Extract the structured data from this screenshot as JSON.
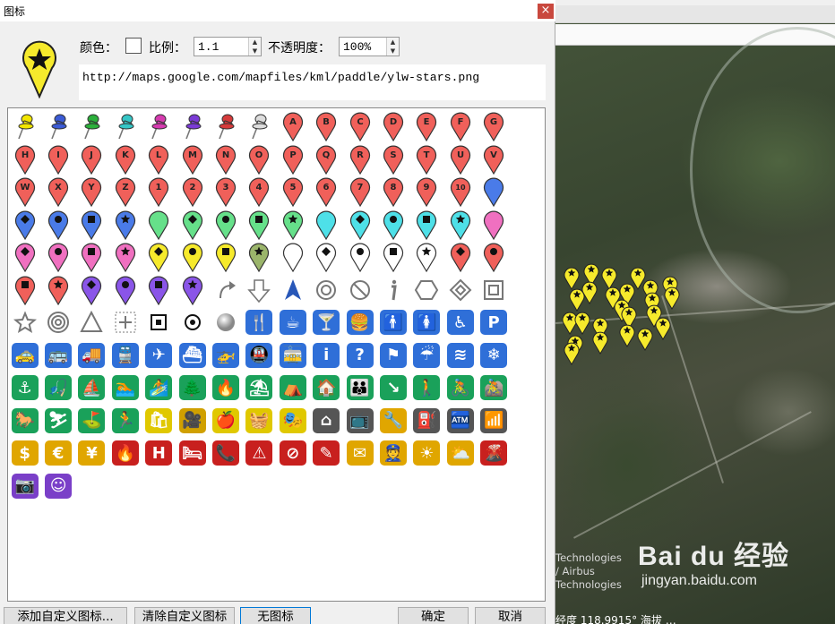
{
  "window": {
    "title": "图标",
    "close_glyph": "×"
  },
  "preview_icon": {
    "color": "#f6ea2c",
    "icon": "star-paddle-icon"
  },
  "controls": {
    "color_label": "颜色：",
    "scale_label": "比例：",
    "scale_value": "1.1",
    "opacity_label": "不透明度：",
    "opacity_value": "100%"
  },
  "icon_url": "http://maps.google.com/mapfiles/kml/paddle/ylw-stars.png",
  "icon_grid": {
    "rows": [
      [
        {
          "t": "pushpin",
          "c": "#f2e600"
        },
        {
          "t": "pushpin",
          "c": "#3b5bd6"
        },
        {
          "t": "pushpin",
          "c": "#2bb03b"
        },
        {
          "t": "pushpin",
          "c": "#35c6c6"
        },
        {
          "t": "pushpin",
          "c": "#d63bb0"
        },
        {
          "t": "pushpin",
          "c": "#7b3bd6"
        },
        {
          "t": "pushpin",
          "c": "#d63b3b"
        },
        {
          "t": "pushpin",
          "c": "#dddddd"
        },
        {
          "t": "paddle",
          "c": "#f0605a",
          "l": "A"
        },
        {
          "t": "paddle",
          "c": "#f0605a",
          "l": "B"
        },
        {
          "t": "paddle",
          "c": "#f0605a",
          "l": "C"
        },
        {
          "t": "paddle",
          "c": "#f0605a",
          "l": "D"
        },
        {
          "t": "paddle",
          "c": "#f0605a",
          "l": "E"
        },
        {
          "t": "paddle",
          "c": "#f0605a",
          "l": "F"
        },
        {
          "t": "paddle",
          "c": "#f0605a",
          "l": "G"
        }
      ],
      [
        {
          "t": "paddle",
          "c": "#f0605a",
          "l": "H"
        },
        {
          "t": "paddle",
          "c": "#f0605a",
          "l": "I"
        },
        {
          "t": "paddle",
          "c": "#f0605a",
          "l": "J"
        },
        {
          "t": "paddle",
          "c": "#f0605a",
          "l": "K"
        },
        {
          "t": "paddle",
          "c": "#f0605a",
          "l": "L"
        },
        {
          "t": "paddle",
          "c": "#f0605a",
          "l": "M"
        },
        {
          "t": "paddle",
          "c": "#f0605a",
          "l": "N"
        },
        {
          "t": "paddle",
          "c": "#f0605a",
          "l": "O"
        },
        {
          "t": "paddle",
          "c": "#f0605a",
          "l": "P"
        },
        {
          "t": "paddle",
          "c": "#f0605a",
          "l": "Q"
        },
        {
          "t": "paddle",
          "c": "#f0605a",
          "l": "R"
        },
        {
          "t": "paddle",
          "c": "#f0605a",
          "l": "S"
        },
        {
          "t": "paddle",
          "c": "#f0605a",
          "l": "T"
        },
        {
          "t": "paddle",
          "c": "#f0605a",
          "l": "U"
        },
        {
          "t": "paddle",
          "c": "#f0605a",
          "l": "V"
        }
      ],
      [
        {
          "t": "paddle",
          "c": "#f0605a",
          "l": "W"
        },
        {
          "t": "paddle",
          "c": "#f0605a",
          "l": "X"
        },
        {
          "t": "paddle",
          "c": "#f0605a",
          "l": "Y"
        },
        {
          "t": "paddle",
          "c": "#f0605a",
          "l": "Z"
        },
        {
          "t": "paddle",
          "c": "#f0605a",
          "l": "1"
        },
        {
          "t": "paddle",
          "c": "#f0605a",
          "l": "2"
        },
        {
          "t": "paddle",
          "c": "#f0605a",
          "l": "3"
        },
        {
          "t": "paddle",
          "c": "#f0605a",
          "l": "4"
        },
        {
          "t": "paddle",
          "c": "#f0605a",
          "l": "5"
        },
        {
          "t": "paddle",
          "c": "#f0605a",
          "l": "6"
        },
        {
          "t": "paddle",
          "c": "#f0605a",
          "l": "7"
        },
        {
          "t": "paddle",
          "c": "#f0605a",
          "l": "8"
        },
        {
          "t": "paddle",
          "c": "#f0605a",
          "l": "9"
        },
        {
          "t": "paddle",
          "c": "#f0605a",
          "l": "10"
        },
        {
          "t": "paddle",
          "c": "#4a7be8",
          "l": ""
        }
      ],
      [
        {
          "t": "paddle",
          "c": "#4a7be8",
          "s": "diamond"
        },
        {
          "t": "paddle",
          "c": "#4a7be8",
          "s": "circle"
        },
        {
          "t": "paddle",
          "c": "#4a7be8",
          "s": "square"
        },
        {
          "t": "paddle",
          "c": "#4a7be8",
          "s": "star"
        },
        {
          "t": "paddle",
          "c": "#66e08a",
          "l": ""
        },
        {
          "t": "paddle",
          "c": "#66e08a",
          "s": "diamond"
        },
        {
          "t": "paddle",
          "c": "#66e08a",
          "s": "circle"
        },
        {
          "t": "paddle",
          "c": "#66e08a",
          "s": "square"
        },
        {
          "t": "paddle",
          "c": "#66e08a",
          "s": "star"
        },
        {
          "t": "paddle",
          "c": "#4ee0e8",
          "l": ""
        },
        {
          "t": "paddle",
          "c": "#4ee0e8",
          "s": "diamond"
        },
        {
          "t": "paddle",
          "c": "#4ee0e8",
          "s": "circle"
        },
        {
          "t": "paddle",
          "c": "#4ee0e8",
          "s": "square"
        },
        {
          "t": "paddle",
          "c": "#4ee0e8",
          "s": "star"
        },
        {
          "t": "paddle",
          "c": "#f070c0",
          "l": ""
        }
      ],
      [
        {
          "t": "paddle",
          "c": "#f070c0",
          "s": "diamond"
        },
        {
          "t": "paddle",
          "c": "#f070c0",
          "s": "circle"
        },
        {
          "t": "paddle",
          "c": "#f070c0",
          "s": "square"
        },
        {
          "t": "paddle",
          "c": "#f070c0",
          "s": "star"
        },
        {
          "t": "paddle",
          "c": "#f6ea2c",
          "s": "diamond"
        },
        {
          "t": "paddle",
          "c": "#f6ea2c",
          "s": "circle"
        },
        {
          "t": "paddle",
          "c": "#f6ea2c",
          "s": "square"
        },
        {
          "t": "paddle",
          "c": "#9bb56b",
          "s": "star"
        },
        {
          "t": "paddle",
          "c": "#ffffff",
          "l": ""
        },
        {
          "t": "paddle",
          "c": "#ffffff",
          "s": "diamond"
        },
        {
          "t": "paddle",
          "c": "#ffffff",
          "s": "circle"
        },
        {
          "t": "paddle",
          "c": "#ffffff",
          "s": "square"
        },
        {
          "t": "paddle",
          "c": "#ffffff",
          "s": "star"
        },
        {
          "t": "paddle",
          "c": "#f0605a",
          "s": "diamond"
        },
        {
          "t": "paddle",
          "c": "#f0605a",
          "s": "circle"
        }
      ],
      [
        {
          "t": "paddle",
          "c": "#f0605a",
          "s": "square"
        },
        {
          "t": "paddle",
          "c": "#f0605a",
          "s": "star"
        },
        {
          "t": "paddle",
          "c": "#8a55e8",
          "s": "diamond"
        },
        {
          "t": "paddle",
          "c": "#8a55e8",
          "s": "circle"
        },
        {
          "t": "paddle",
          "c": "#8a55e8",
          "s": "square"
        },
        {
          "t": "paddle",
          "c": "#8a55e8",
          "s": "star"
        },
        {
          "t": "shape",
          "n": "curved-arrow"
        },
        {
          "t": "shape",
          "n": "down-arrow"
        },
        {
          "t": "shape",
          "n": "nav-arrow"
        },
        {
          "t": "shape",
          "n": "ring"
        },
        {
          "t": "shape",
          "n": "no-entry"
        },
        {
          "t": "shape",
          "n": "info-i"
        },
        {
          "t": "shape",
          "n": "hexagon"
        },
        {
          "t": "shape",
          "n": "diamond-outline"
        },
        {
          "t": "shape",
          "n": "square-outline"
        }
      ],
      [
        {
          "t": "shape",
          "n": "star-outline"
        },
        {
          "t": "shape",
          "n": "target"
        },
        {
          "t": "shape",
          "n": "triangle"
        },
        {
          "t": "shape",
          "n": "cross-hair"
        },
        {
          "t": "shape",
          "n": "square-dot"
        },
        {
          "t": "shape",
          "n": "circle-dot"
        },
        {
          "t": "shape",
          "n": "grey-sphere"
        },
        {
          "t": "sym",
          "g": "🍴"
        },
        {
          "t": "sym",
          "g": "☕"
        },
        {
          "t": "sym",
          "g": "🍸"
        },
        {
          "t": "sym",
          "g": "🍔"
        },
        {
          "t": "sym",
          "g": "🚹"
        },
        {
          "t": "sym",
          "g": "🚺"
        },
        {
          "t": "sym",
          "g": "♿"
        },
        {
          "t": "sym",
          "g": "P"
        }
      ],
      [
        {
          "t": "sym",
          "g": "🚕"
        },
        {
          "t": "sym",
          "g": "🚌"
        },
        {
          "t": "sym",
          "g": "🚚"
        },
        {
          "t": "sym",
          "g": "🚆"
        },
        {
          "t": "sym",
          "g": "✈"
        },
        {
          "t": "sym",
          "g": "⛴"
        },
        {
          "t": "sym",
          "g": "🚁"
        },
        {
          "t": "sym",
          "g": "🚇"
        },
        {
          "t": "sym",
          "g": "🚋"
        },
        {
          "t": "sym",
          "g": "i"
        },
        {
          "t": "sym",
          "g": "?"
        },
        {
          "t": "sym",
          "g": "⚑"
        },
        {
          "t": "sym",
          "g": "☔"
        },
        {
          "t": "sym",
          "g": "≋"
        },
        {
          "t": "sym",
          "g": "❄"
        }
      ],
      [
        {
          "t": "sym",
          "g": "⚓"
        },
        {
          "t": "sym",
          "g": "🎣"
        },
        {
          "t": "sym",
          "g": "⛵"
        },
        {
          "t": "sym",
          "g": "🏊"
        },
        {
          "t": "sym",
          "g": "🏄"
        },
        {
          "t": "sym",
          "g": "🌲"
        },
        {
          "t": "sym",
          "g": "🔥"
        },
        {
          "t": "sym",
          "g": "⛱"
        },
        {
          "t": "sym",
          "g": "⛺"
        },
        {
          "t": "sym",
          "g": "🏠"
        },
        {
          "t": "sym",
          "g": "👪"
        },
        {
          "t": "sym",
          "g": "↘"
        },
        {
          "t": "sym",
          "g": "🚶"
        },
        {
          "t": "sym",
          "g": "🚴"
        },
        {
          "t": "sym",
          "g": "🚵"
        }
      ],
      [
        {
          "t": "sym",
          "g": "🐎"
        },
        {
          "t": "sym",
          "g": "⛷"
        },
        {
          "t": "sym",
          "g": "⛳"
        },
        {
          "t": "sym",
          "g": "🏃"
        },
        {
          "t": "sym",
          "g": "🛍"
        },
        {
          "t": "sym",
          "g": "🎥"
        },
        {
          "t": "sym",
          "g": "🍎"
        },
        {
          "t": "sym",
          "g": "🧺"
        },
        {
          "t": "sym",
          "g": "🎭"
        },
        {
          "t": "sym",
          "g": "⌂"
        },
        {
          "t": "sym",
          "g": "📺"
        },
        {
          "t": "sym",
          "g": "🔧"
        },
        {
          "t": "sym",
          "g": "⛽"
        },
        {
          "t": "sym",
          "g": "🏧"
        },
        {
          "t": "sym",
          "g": "📶"
        }
      ],
      [
        {
          "t": "sym",
          "g": "$"
        },
        {
          "t": "sym",
          "g": "€"
        },
        {
          "t": "sym",
          "g": "¥"
        },
        {
          "t": "sym",
          "g": "🔥"
        },
        {
          "t": "sym",
          "g": "H"
        },
        {
          "t": "sym",
          "g": "🛏"
        },
        {
          "t": "sym",
          "g": "📞"
        },
        {
          "t": "sym",
          "g": "⚠"
        },
        {
          "t": "sym",
          "g": "⊘"
        },
        {
          "t": "sym",
          "g": "✎"
        },
        {
          "t": "sym",
          "g": "✉"
        },
        {
          "t": "sym",
          "g": "👮"
        },
        {
          "t": "sym",
          "g": "☀"
        },
        {
          "t": "sym",
          "g": "⛅"
        },
        {
          "t": "sym",
          "g": "🌋"
        }
      ],
      [
        {
          "t": "sym",
          "g": "📷"
        },
        {
          "t": "sym",
          "g": "☺"
        }
      ]
    ]
  },
  "buttons": {
    "add_custom": "添加自定义图标...",
    "clear_custom": "清除自定义图标",
    "no_icon": "无图标",
    "ok": "确定",
    "cancel": "取消"
  },
  "map": {
    "credits": [
      "Technologies",
      "/ Airbus",
      "Technologies"
    ],
    "watermark_logo": "Bai du 经验",
    "watermark_url": "jingyan.baidu.com",
    "status_text": "经度  118.9915°  海拔  …"
  }
}
